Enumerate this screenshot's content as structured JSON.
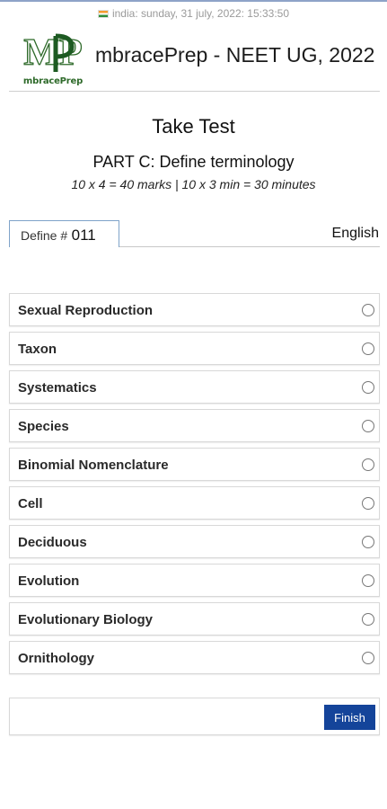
{
  "datebar": {
    "text": "india: sunday, 31 july, 2022: 15:33:50",
    "icon": "india-flag-icon"
  },
  "header": {
    "logo_text": "mbracePrep",
    "logo_letters": "MP",
    "title": "mbracePrep - NEET UG, 2022"
  },
  "page": {
    "title": "Take Test",
    "part_title": "PART C: Define terminology",
    "marks": "10 x 4 = 40 marks | 10 x 3 min = 30 minutes"
  },
  "question_tab": {
    "label": "Define #",
    "number": "011"
  },
  "language": "English",
  "options": [
    "Sexual Reproduction",
    "Taxon",
    "Systematics",
    "Species",
    "Binomial Nomenclature",
    "Cell",
    "Deciduous",
    "Evolution",
    "Evolutionary Biology",
    "Ornithology"
  ],
  "finish_label": "Finish",
  "colors": {
    "accent": "#14449a",
    "logo_green": "#2e6a2a",
    "tab_border": "#7fa3c9"
  }
}
